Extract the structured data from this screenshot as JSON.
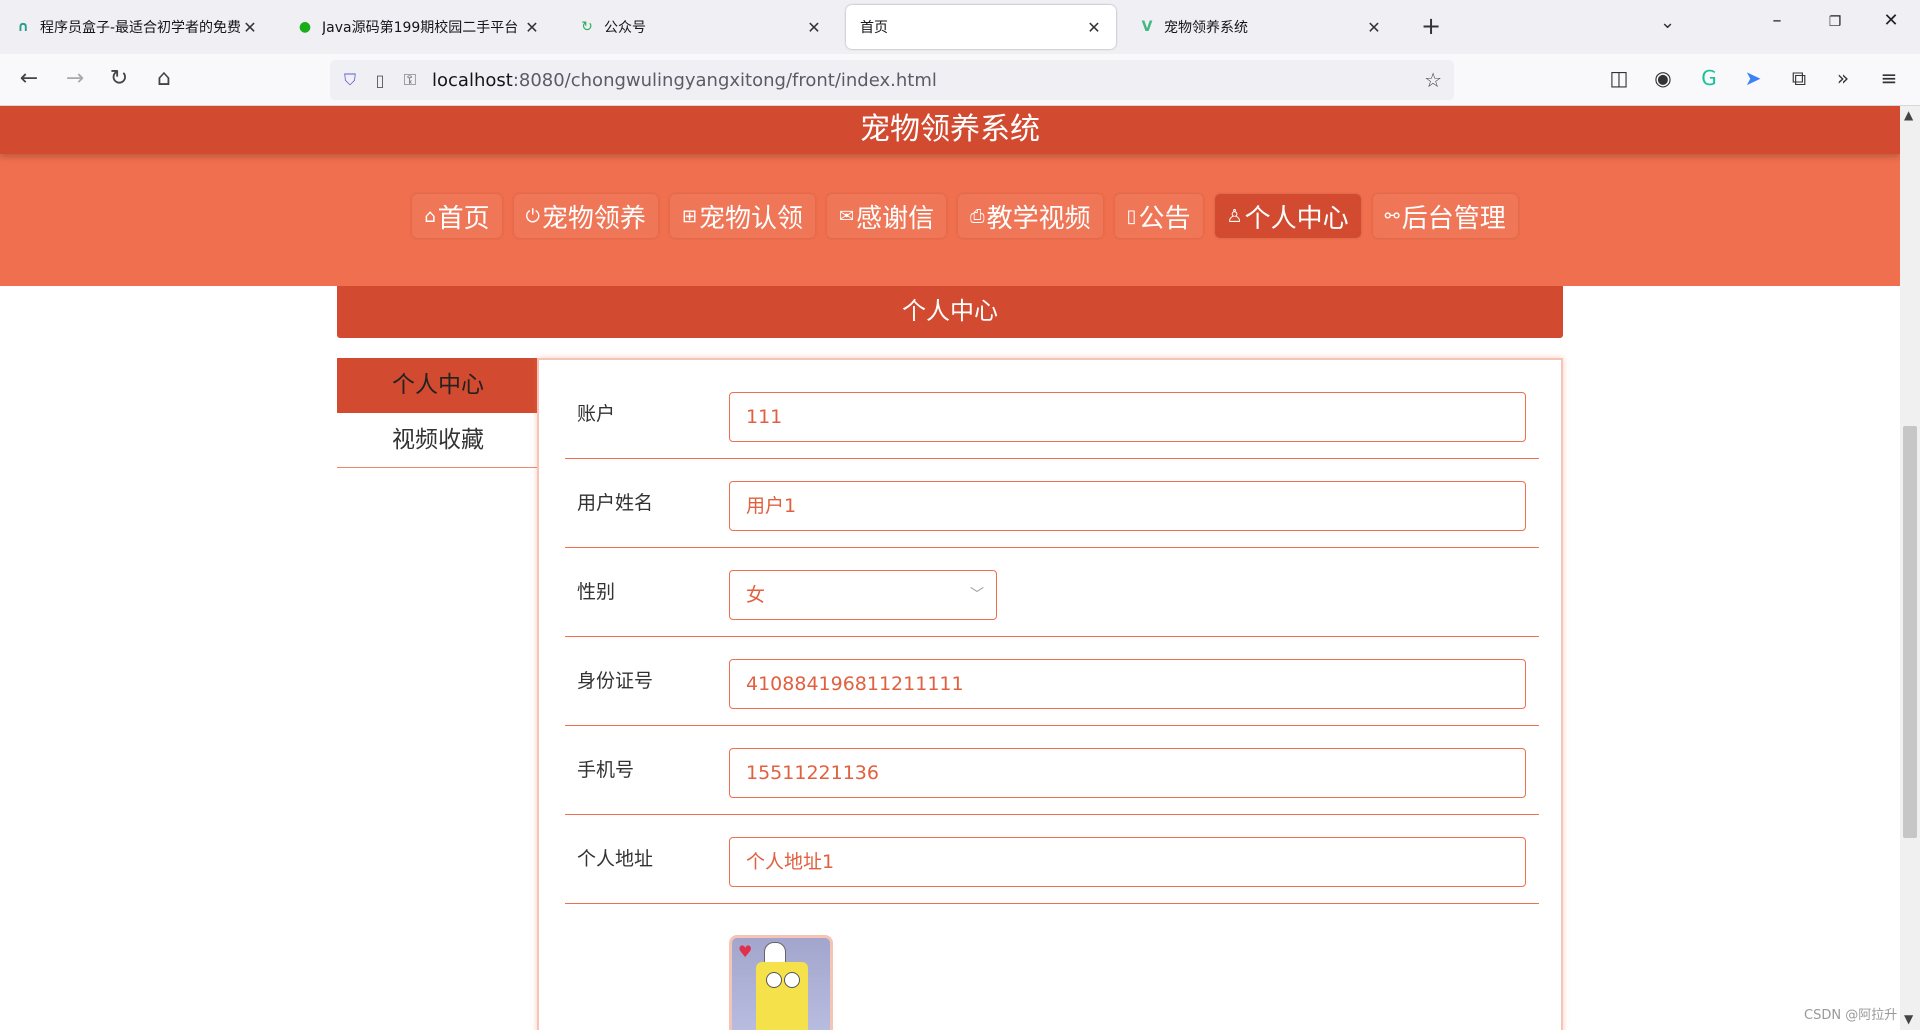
{
  "browser": {
    "tabs": [
      {
        "title": "程序员盒子-最适合初学者的免费",
        "icon": "n-logo-icon",
        "color": "#2a9d8f"
      },
      {
        "title": "Java源码第199期校园二手平台",
        "icon": "wechat-icon",
        "color": "#1aad19"
      },
      {
        "title": "公众号",
        "icon": "loop-icon",
        "color": "#27b25b"
      },
      {
        "title": "首页",
        "icon": "",
        "color": ""
      },
      {
        "title": "宠物领养系统",
        "icon": "vue-icon",
        "color": "#41b883"
      }
    ],
    "url_host": "localhost",
    "url_path": ":8080/chongwulingyangxitong/front/index.html"
  },
  "site": {
    "title": "宠物领养系统",
    "menu": [
      {
        "icon": "⌂",
        "label": "首页"
      },
      {
        "icon": "⏻",
        "label": "宠物领养"
      },
      {
        "icon": "⊞",
        "label": "宠物认领"
      },
      {
        "icon": "✉",
        "label": "感谢信"
      },
      {
        "icon": "⎙",
        "label": "教学视频"
      },
      {
        "icon": "▯",
        "label": "公告"
      },
      {
        "icon": "♙",
        "label": "个人中心"
      },
      {
        "icon": "⚯",
        "label": "后台管理"
      }
    ],
    "active_menu": "个人中心"
  },
  "page": {
    "title": "个人中心",
    "sidebar": [
      "个人中心",
      "视频收藏"
    ]
  },
  "form": {
    "account_label": "账户",
    "account_value": "111",
    "name_label": "用户姓名",
    "name_value": "用户1",
    "gender_label": "性别",
    "gender_value": "女",
    "id_label": "身份证号",
    "id_value": "410884196811211111",
    "phone_label": "手机号",
    "phone_value": "15511221136",
    "address_label": "个人地址",
    "address_value": "个人地址1"
  },
  "watermark": "CSDN @阿拉升"
}
